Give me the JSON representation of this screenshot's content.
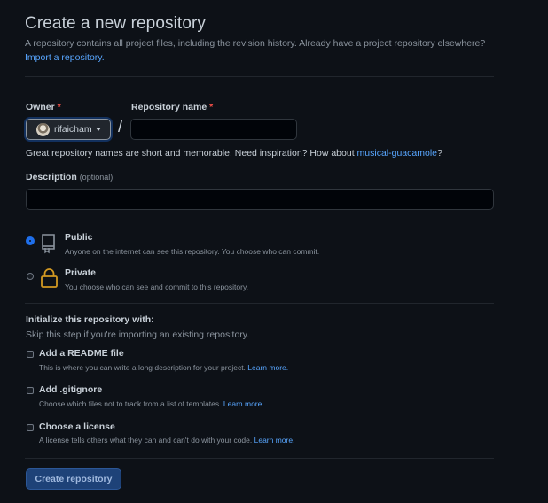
{
  "header": {
    "title": "Create a new repository",
    "subtitle": "A repository contains all project files, including the revision history. Already have a project repository elsewhere?",
    "import_link": "Import a repository."
  },
  "owner": {
    "label": "Owner",
    "required_mark": "*",
    "username": "rifaicham"
  },
  "repo_name": {
    "label": "Repository name",
    "required_mark": "*",
    "value": "",
    "separator": "/"
  },
  "name_hint": {
    "text": "Great repository names are short and memorable. Need inspiration? How about ",
    "suggestion": "musical-guacamole",
    "suffix": "?"
  },
  "description": {
    "label": "Description",
    "optional": "(optional)",
    "value": ""
  },
  "visibility": {
    "selected": "public",
    "public": {
      "title": "Public",
      "desc": "Anyone on the internet can see this repository. You choose who can commit.",
      "icon": "repo-book-icon"
    },
    "private": {
      "title": "Private",
      "desc": "You choose who can see and commit to this repository.",
      "icon": "lock-icon"
    }
  },
  "init": {
    "title": "Initialize this repository with:",
    "subtitle": "Skip this step if you're importing an existing repository.",
    "readme": {
      "label": "Add a README file",
      "desc": "This is where you can write a long description for your project.",
      "link": "Learn more.",
      "checked": false
    },
    "gitignore": {
      "label": "Add .gitignore",
      "desc": "Choose which files not to track from a list of templates.",
      "link": "Learn more.",
      "checked": false
    },
    "license": {
      "label": "Choose a license",
      "desc": "A license tells others what they can and can't do with your code.",
      "link": "Learn more.",
      "checked": false
    }
  },
  "submit": {
    "label": "Create repository"
  },
  "colors": {
    "background": "#0d1117",
    "link": "#58a6ff",
    "required": "#f85149",
    "radio_selected": "#1f6feb",
    "lock_icon": "#d29922",
    "button_bg": "#1e4278"
  }
}
